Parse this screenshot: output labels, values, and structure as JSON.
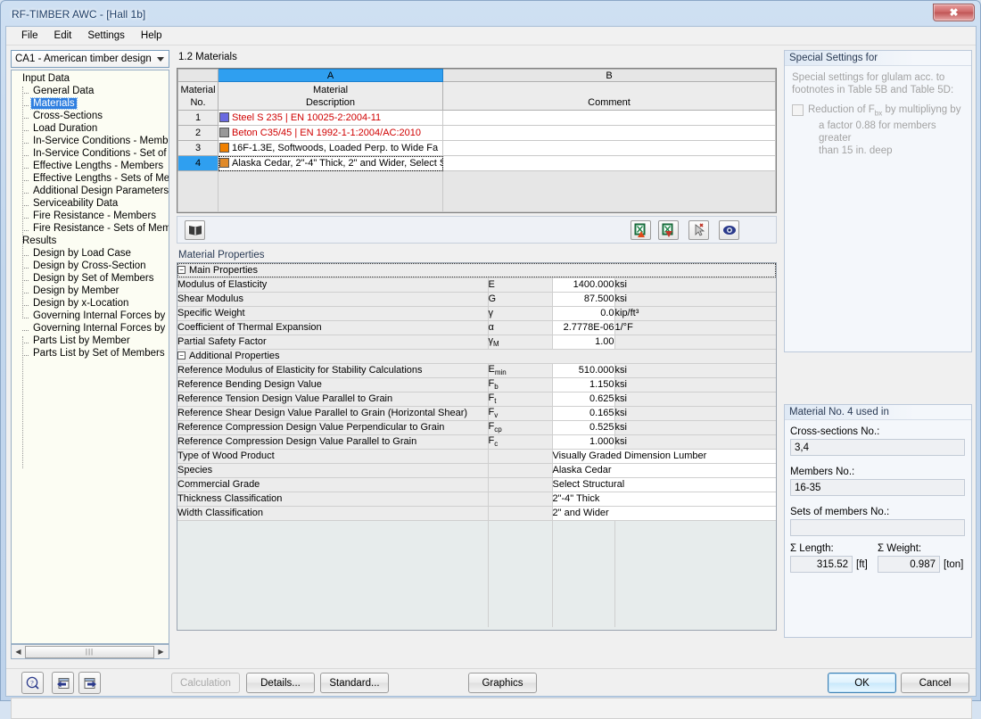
{
  "window": {
    "title": "RF-TIMBER AWC - [Hall 1b]",
    "close_label": "✕"
  },
  "menubar": {
    "items": [
      {
        "label": "File"
      },
      {
        "label": "Edit"
      },
      {
        "label": "Settings"
      },
      {
        "label": "Help"
      }
    ]
  },
  "nav": {
    "selector_value": "CA1 - American timber design",
    "groups": [
      {
        "label": "Input Data",
        "items": [
          {
            "label": "General Data",
            "selected": false
          },
          {
            "label": "Materials",
            "selected": true
          },
          {
            "label": "Cross-Sections",
            "selected": false
          },
          {
            "label": "Load Duration",
            "selected": false
          },
          {
            "label": "In-Service Conditions - Members",
            "selected": false
          },
          {
            "label": "In-Service Conditions - Set of M",
            "selected": false
          },
          {
            "label": "Effective Lengths - Members",
            "selected": false
          },
          {
            "label": "Effective Lengths - Sets of Mem",
            "selected": false
          },
          {
            "label": "Additional Design Parameters",
            "selected": false
          },
          {
            "label": "Serviceability Data",
            "selected": false
          },
          {
            "label": "Fire Resistance - Members",
            "selected": false
          },
          {
            "label": "Fire Resistance - Sets of Memb",
            "selected": false
          }
        ]
      },
      {
        "label": "Results",
        "items": [
          {
            "label": "Design by Load Case",
            "selected": false
          },
          {
            "label": "Design by Cross-Section",
            "selected": false
          },
          {
            "label": "Design by Set of Members",
            "selected": false
          },
          {
            "label": "Design by Member",
            "selected": false
          },
          {
            "label": "Design by x-Location",
            "selected": false
          },
          {
            "label": "Governing Internal Forces by M",
            "selected": false
          },
          {
            "label": "Governing Internal Forces by Se",
            "selected": false
          },
          {
            "label": "Parts List by Member",
            "selected": false
          },
          {
            "label": "Parts List by Set of Members",
            "selected": false
          }
        ]
      }
    ]
  },
  "main": {
    "panel_title": "1.2 Materials",
    "materials_table": {
      "col_letters": [
        "A",
        "B"
      ],
      "corner_header": [
        "Material",
        "No."
      ],
      "headers": [
        {
          "line1": "Material",
          "line2": "Description"
        },
        {
          "line1": "",
          "line2": "Comment"
        }
      ],
      "rows": [
        {
          "no": "1",
          "swatch": "#6a6ae0",
          "description": "Steel S 235 | EN 10025-2:2004-11",
          "comment": "",
          "color": "red",
          "selected": false,
          "editing": false
        },
        {
          "no": "2",
          "swatch": "#999999",
          "description": "Beton C35/45 | EN 1992-1-1:2004/AC:2010",
          "comment": "",
          "color": "red",
          "selected": false,
          "editing": false
        },
        {
          "no": "3",
          "swatch": "#f08000",
          "description": "16F-1.3E, Softwoods, Loaded Perp. to Wide Fa",
          "comment": "",
          "color": "black",
          "selected": false,
          "editing": false
        },
        {
          "no": "4",
          "swatch": "#e08a2a",
          "description": "Alaska Cedar, 2\"-4\" Thick, 2\" and Wider, Select S",
          "comment": "",
          "color": "black",
          "selected": true,
          "editing": true
        }
      ]
    },
    "table_toolbar": {
      "library_icon": "library-book-icon",
      "import_icon": "import-from-excel-icon",
      "export_icon": "export-to-excel-icon",
      "pick_icon": "pick-from-model-icon",
      "view_icon": "view-mode-icon"
    },
    "properties_label": "Material Properties",
    "properties": [
      {
        "kind": "section",
        "label": "Main Properties",
        "focused": true
      },
      {
        "kind": "value",
        "label": "Modulus of Elasticity",
        "sym": "E",
        "sub": "",
        "value": "1400.000",
        "unit": "ksi"
      },
      {
        "kind": "value",
        "label": "Shear Modulus",
        "sym": "G",
        "sub": "",
        "value": "87.500",
        "unit": "ksi"
      },
      {
        "kind": "value",
        "label": "Specific Weight",
        "sym": "γ",
        "sub": "",
        "value": "0.0",
        "unit": "kip/ft³"
      },
      {
        "kind": "value",
        "label": "Coefficient of Thermal Expansion",
        "sym": "α",
        "sub": "",
        "value": "2.7778E-06",
        "unit": "1/°F"
      },
      {
        "kind": "value",
        "label": "Partial Safety Factor",
        "sym": "γ",
        "sub": "M",
        "value": "1.00",
        "unit": ""
      },
      {
        "kind": "section",
        "label": "Additional Properties",
        "focused": false
      },
      {
        "kind": "value",
        "label": "Reference Modulus of Elasticity for Stability Calculations",
        "sym": "E",
        "sub": "min",
        "value": "510.000",
        "unit": "ksi"
      },
      {
        "kind": "value",
        "label": "Reference Bending Design Value",
        "sym": "F",
        "sub": "b",
        "value": "1.150",
        "unit": "ksi"
      },
      {
        "kind": "value",
        "label": "Reference Tension Design Value Parallel to Grain",
        "sym": "F",
        "sub": "t",
        "value": "0.625",
        "unit": "ksi"
      },
      {
        "kind": "value",
        "label": "Reference Shear Design Value Parallel to Grain (Horizontal Shear)",
        "sym": "F",
        "sub": "v",
        "value": "0.165",
        "unit": "ksi"
      },
      {
        "kind": "value",
        "label": "Reference Compression Design Value Perpendicular to Grain",
        "sym": "F",
        "sub": "cp",
        "value": "0.525",
        "unit": "ksi"
      },
      {
        "kind": "value",
        "label": "Reference Compression Design Value Parallel to Grain",
        "sym": "F",
        "sub": "c",
        "value": "1.000",
        "unit": "ksi"
      },
      {
        "kind": "text",
        "label": "Type of Wood Product",
        "sym": "",
        "sub": "",
        "value": "Visually Graded Dimension Lumber",
        "unit": ""
      },
      {
        "kind": "text",
        "label": "Species",
        "sym": "",
        "sub": "",
        "value": "Alaska Cedar",
        "unit": ""
      },
      {
        "kind": "text",
        "label": "Commercial Grade",
        "sym": "",
        "sub": "",
        "value": "Select Structural",
        "unit": ""
      },
      {
        "kind": "text",
        "label": "Thickness Classification",
        "sym": "",
        "sub": "",
        "value": "2\"-4\" Thick",
        "unit": ""
      },
      {
        "kind": "text",
        "label": "Width Classification",
        "sym": "",
        "sub": "",
        "value": "2\" and Wider",
        "unit": ""
      }
    ]
  },
  "right": {
    "special_settings": {
      "title": "Special Settings for",
      "intro_line1": "Special settings for glulam acc. to",
      "intro_line2": "footnotes in Table 5B and Table 5D:",
      "checkbox_checked": false,
      "checkbox_line1_a": "Reduction of F",
      "checkbox_line1_sub": "bx",
      "checkbox_line1_b": " by multipliyng by",
      "checkbox_line2": "a factor 0.88 for members greater",
      "checkbox_line3": "than 15 in. deep"
    },
    "used_in": {
      "title": "Material No. 4 used in",
      "cross_sections_label": "Cross-sections No.:",
      "cross_sections_value": "3,4",
      "members_label": "Members No.:",
      "members_value": "16-35",
      "sets_label": "Sets of members No.:",
      "sets_value": "",
      "length_label": "Σ Length:",
      "length_value": "315.52",
      "length_unit": "[ft]",
      "weight_label": "Σ Weight:",
      "weight_value": "0.987",
      "weight_unit": "[ton]"
    }
  },
  "bottom": {
    "help_icon": "help-question-icon",
    "prev_icon": "previous-panel-icon",
    "next_icon": "next-panel-icon",
    "calculation_label": "Calculation",
    "details_label": "Details...",
    "standard_label": "Standard...",
    "graphics_label": "Graphics",
    "ok_label": "OK",
    "cancel_label": "Cancel"
  },
  "colors": {
    "accent": "#2f9ff0",
    "title_text": "#1d3d66",
    "red_material": "#d00000"
  }
}
